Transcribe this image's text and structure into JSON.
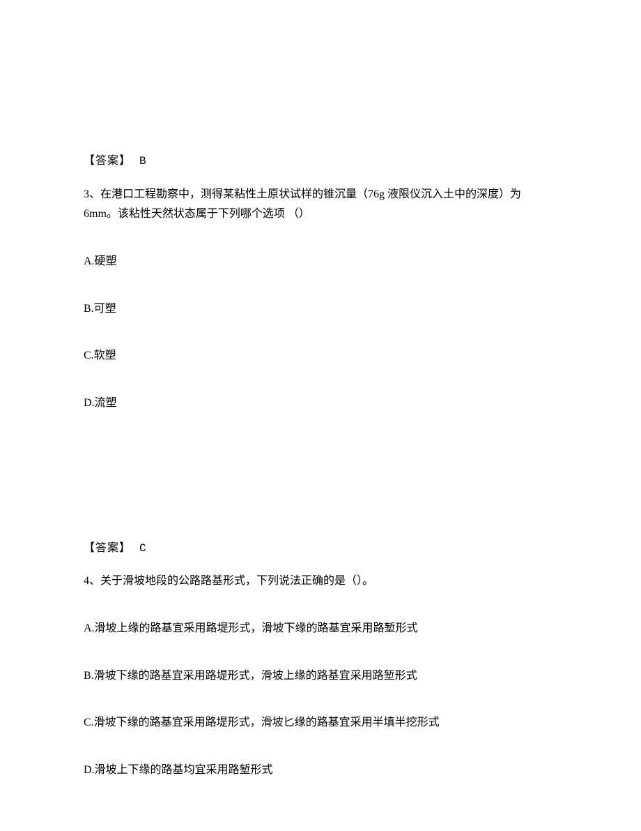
{
  "q3": {
    "prev_answer_label": "【答案】",
    "prev_answer_value": "B",
    "question": "3、在港口工程勘察中，测得某粘性土原状试样的锥沉量（76g 液限仪沉入土中的深度）为 6mm。该粘性天然状态属于下列哪个选项 （）",
    "options": {
      "a": "A.硬塑",
      "b": "B.可塑",
      "c": "C.软塑",
      "d": "D.流塑"
    },
    "answer_label": "【答案】",
    "answer_value": "C"
  },
  "q4": {
    "question": "4、关于滑坡地段的公路路基形式，下列说法正确的是（）。",
    "options": {
      "a": "A.滑坡上缘的路基宜采用路堤形式，滑坡下缘的路基宜采用路堑形式",
      "b": "B.滑坡下缘的路基宜采用路堤形式，滑坡上缘的路基宜采用路堑形式",
      "c": "C.滑坡下缘的路基宜采用路堤形式，滑坡匕缘的路基宜采用半填半挖形式",
      "d": "D.滑坡上下缘的路基均宜采用路堑形式"
    }
  }
}
